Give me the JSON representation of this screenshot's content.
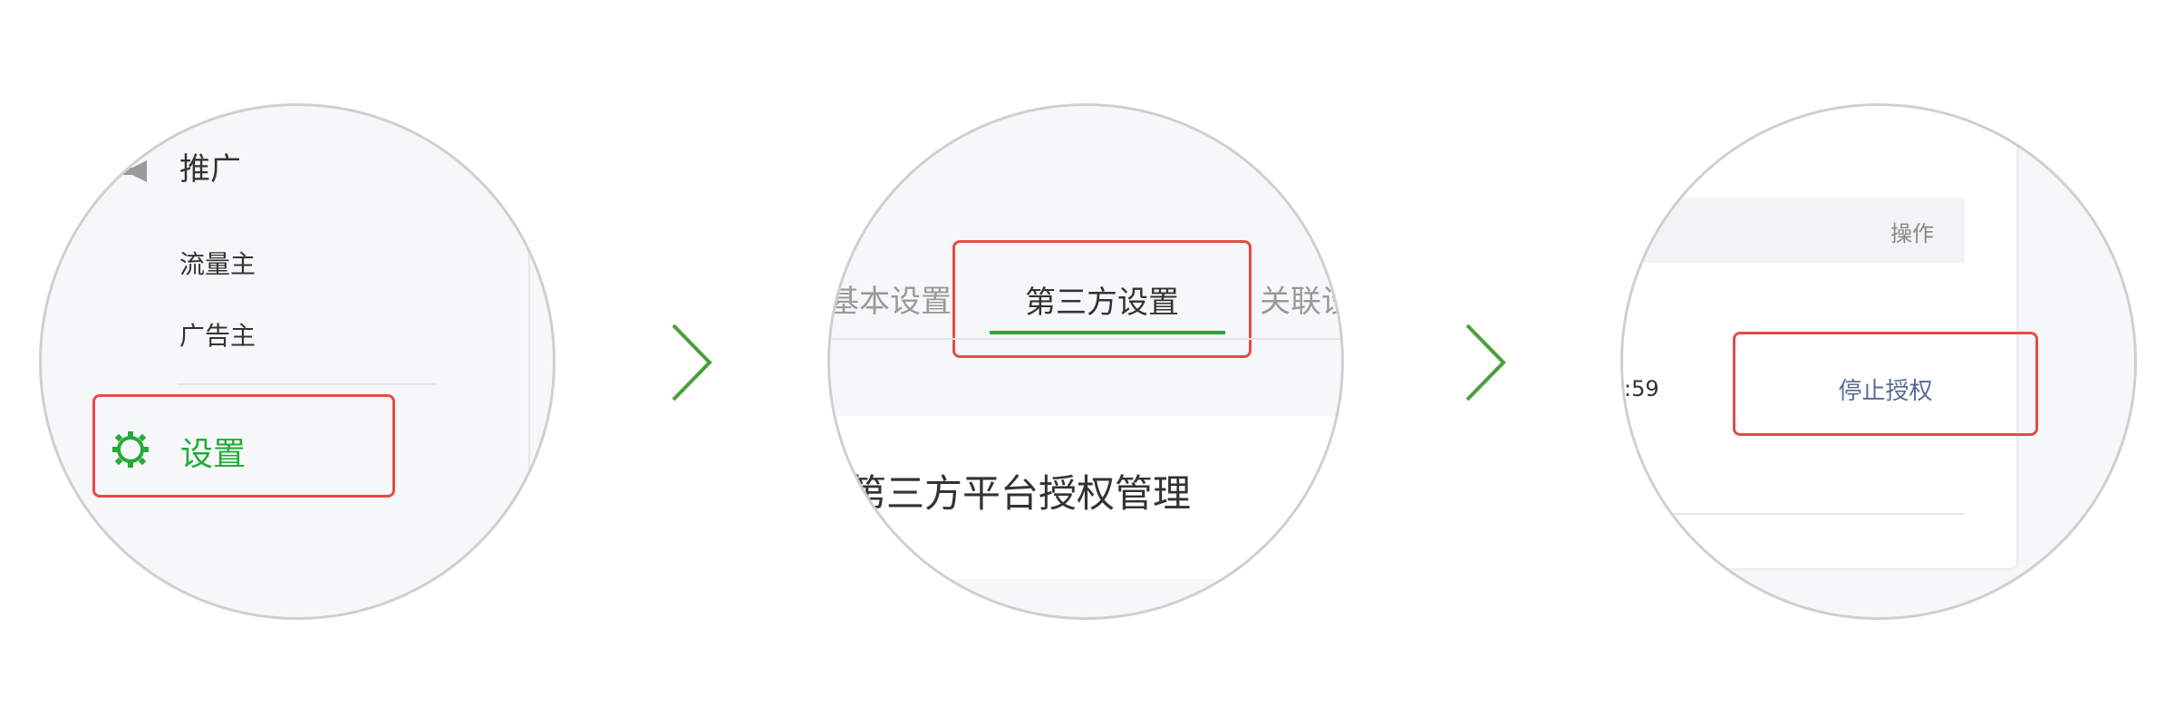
{
  "panel1": {
    "nav_title": "推广",
    "sub_items": [
      "流量主",
      "广告主"
    ],
    "settings_label": "设置",
    "accent_color": "#22ac38",
    "highlight_color": "#e84a46"
  },
  "panel2": {
    "tabs": {
      "left_partial": "基本设置",
      "active": "第三方设置",
      "right_partial": "关联设"
    },
    "card_title": "第三方平台授权管理"
  },
  "panel3": {
    "column_header": "操作",
    "time_fragment": ":59",
    "stop_auth_label": "停止授权",
    "link_color": "#576b95"
  },
  "icons": {
    "nav": "megaphone-icon",
    "settings": "gear-icon",
    "arrow": "chevron-right-icon"
  }
}
